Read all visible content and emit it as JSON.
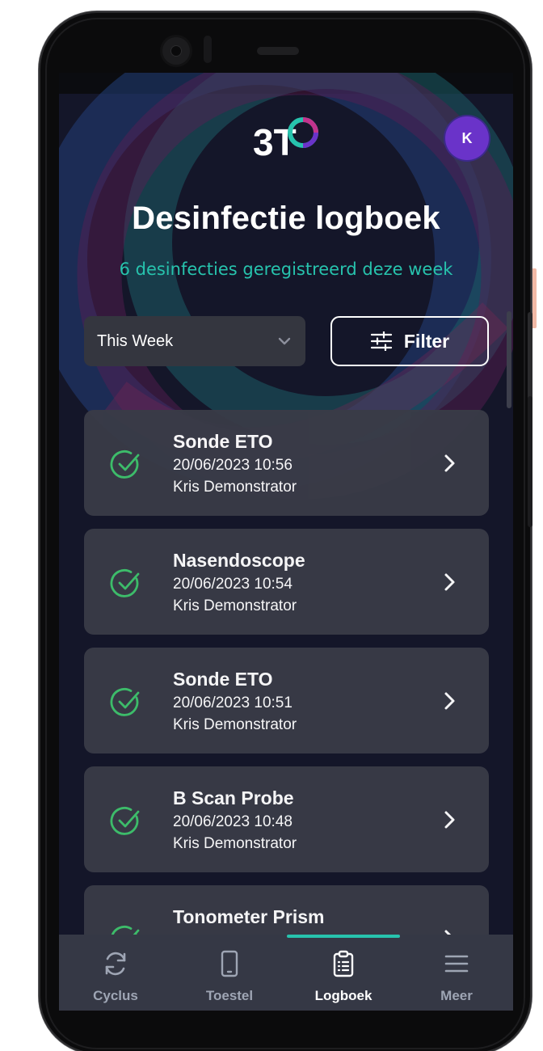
{
  "app": {
    "logo_text": "3T",
    "avatar_initial": "K"
  },
  "header": {
    "title": "Desinfectie logboek",
    "subtitle": "6 desinfecties geregistreerd deze week"
  },
  "controls": {
    "period_value": "This Week",
    "filter_label": "Filter"
  },
  "log_entries": [
    {
      "name": "Sonde ETO",
      "datetime": "20/06/2023 10:56",
      "user": "Kris Demonstrator",
      "status": "check-circle-icon"
    },
    {
      "name": "Nasendoscope",
      "datetime": "20/06/2023 10:54",
      "user": "Kris Demonstrator",
      "status": "check-circle-icon"
    },
    {
      "name": "Sonde ETO",
      "datetime": "20/06/2023 10:51",
      "user": "Kris Demonstrator",
      "status": "check-circle-icon"
    },
    {
      "name": "B Scan Probe",
      "datetime": "20/06/2023 10:48",
      "user": "Kris Demonstrator",
      "status": "check-circle-icon"
    },
    {
      "name": "Tonometer Prism",
      "datetime": "",
      "user": "",
      "status": "check-circle-icon"
    }
  ],
  "tabbar": {
    "tabs": [
      {
        "label": "Cyclus",
        "icon": "sync-icon",
        "active": false
      },
      {
        "label": "Toestel",
        "icon": "phone-icon",
        "active": false
      },
      {
        "label": "Logboek",
        "icon": "clipboard-icon",
        "active": true
      },
      {
        "label": "Meer",
        "icon": "menu-icon",
        "active": false
      }
    ]
  },
  "colors": {
    "accent_teal": "#27c3ad",
    "success_green": "#3fc36d",
    "avatar_purple": "#6a33c9",
    "screen_bg": "#141629",
    "card_bg": "#393b47"
  }
}
